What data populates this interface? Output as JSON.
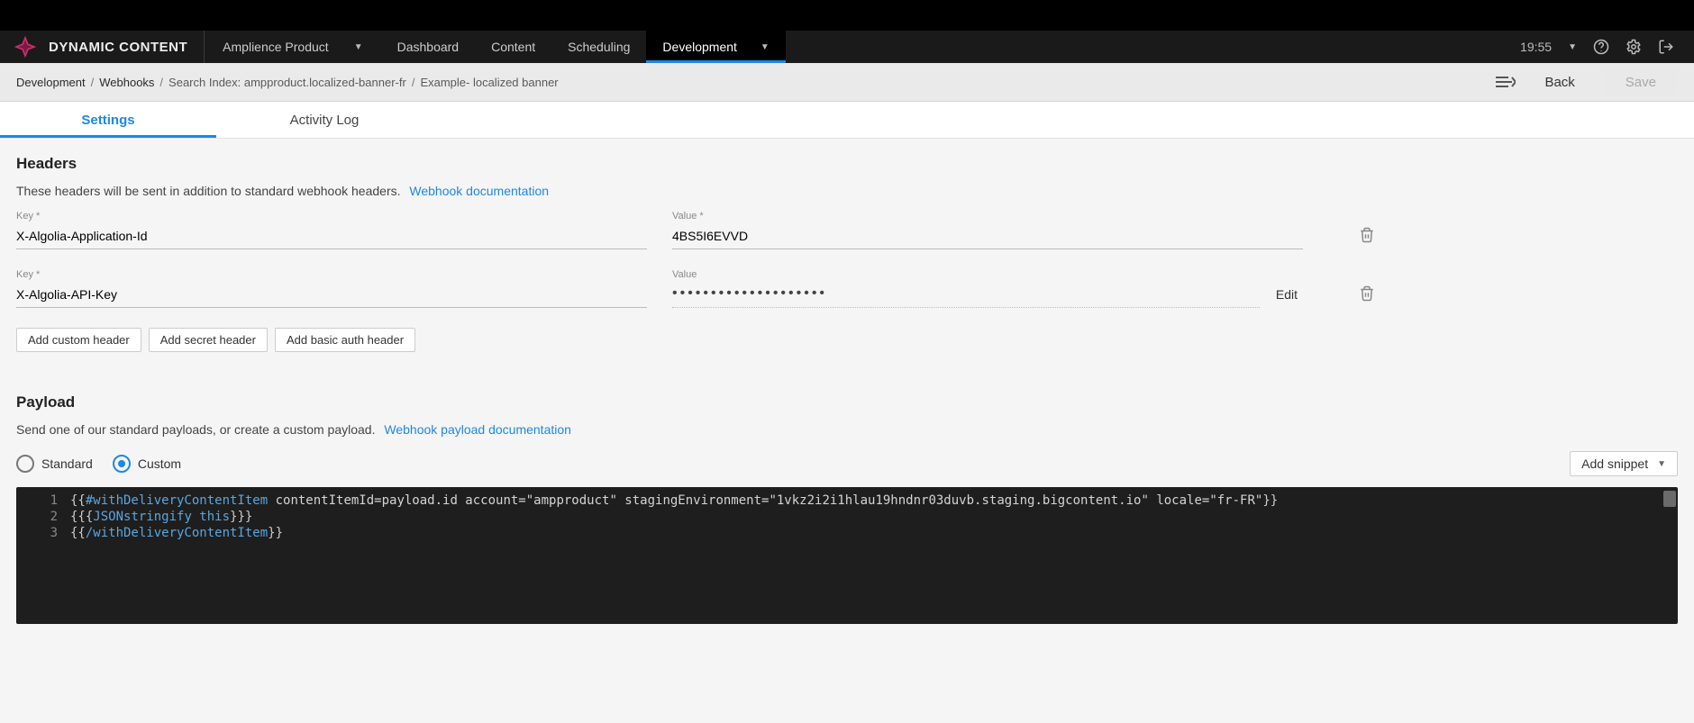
{
  "app": {
    "logo_text": "DYNAMIC CONTENT",
    "hub_name": "Amplience Product"
  },
  "nav": {
    "items": [
      "Dashboard",
      "Content",
      "Scheduling",
      "Development"
    ],
    "active_index": 3
  },
  "header_right": {
    "time": "19:55"
  },
  "breadcrumb": {
    "items": [
      {
        "label": "Development",
        "link": true
      },
      {
        "label": "Webhooks",
        "link": true
      },
      {
        "label": "Search Index: ampproduct.localized-banner-fr",
        "link": false
      },
      {
        "label": "Example- localized banner",
        "link": false
      }
    ],
    "back_label": "Back",
    "save_label": "Save"
  },
  "tabs": {
    "items": [
      "Settings",
      "Activity Log"
    ],
    "active_index": 0
  },
  "headers_section": {
    "title": "Headers",
    "desc": "These headers will be sent in addition to standard webhook headers.",
    "doc_link_label": "Webhook documentation",
    "rows": [
      {
        "key_label": "Key *",
        "key_value": "X-Algolia-Application-Id",
        "value_label": "Value *",
        "value_value": "4BS5I6EVVD",
        "secret": false
      },
      {
        "key_label": "Key *",
        "key_value": "X-Algolia-API-Key",
        "value_label": "Value",
        "value_value": "••••••••••••••••••••",
        "secret": true,
        "edit_label": "Edit"
      }
    ],
    "buttons": {
      "custom": "Add custom header",
      "secret": "Add secret header",
      "basic_auth": "Add basic auth header"
    }
  },
  "payload_section": {
    "title": "Payload",
    "desc": "Send one of our standard payloads, or create a custom payload.",
    "doc_link_label": "Webhook payload documentation",
    "radio_standard": "Standard",
    "radio_custom": "Custom",
    "selected": "custom",
    "snippet_btn": "Add snippet",
    "code_lines": [
      {
        "n": "1",
        "segments": [
          {
            "cls": "tok-outer",
            "t": "{{"
          },
          {
            "cls": "tok-helper",
            "t": "#withDeliveryContentItem"
          },
          {
            "cls": "tok-param",
            "t": " contentItemId=payload.id account=\"ampproduct\" stagingEnvironment=\"1vkz2i2i1hlau19hndnr03duvb.staging.bigcontent.io\" locale=\"fr-FR\""
          },
          {
            "cls": "tok-outer",
            "t": "}}"
          }
        ]
      },
      {
        "n": "2",
        "segments": [
          {
            "cls": "tok-outer",
            "t": "{{{"
          },
          {
            "cls": "tok-helper",
            "t": "JSONstringify this"
          },
          {
            "cls": "tok-outer",
            "t": "}}}"
          }
        ]
      },
      {
        "n": "3",
        "segments": [
          {
            "cls": "tok-outer",
            "t": "{{"
          },
          {
            "cls": "tok-close",
            "t": "/withDeliveryContentItem"
          },
          {
            "cls": "tok-outer",
            "t": "}}"
          }
        ]
      }
    ]
  }
}
